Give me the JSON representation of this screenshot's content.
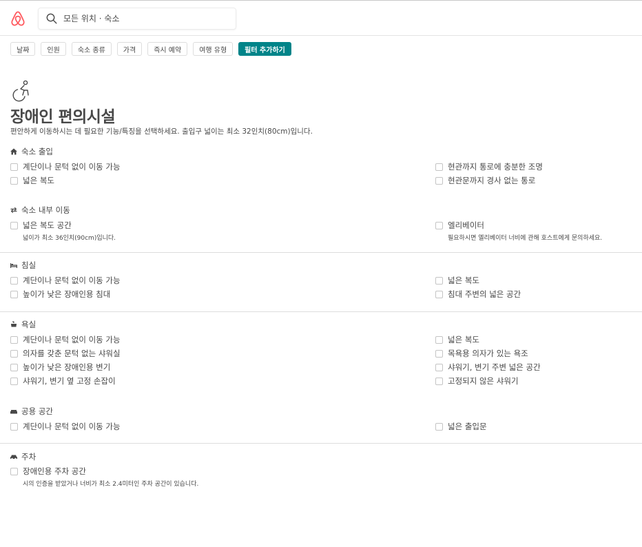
{
  "search": {
    "placeholder": "모든 위치 · 숙소"
  },
  "filters": [
    "날짜",
    "인원",
    "숙소 종류",
    "가격",
    "즉시 예약",
    "여행 유형"
  ],
  "more_filters_label": "필터 추가하기",
  "page": {
    "title": "장애인 편의시설",
    "description": "편안하게 이동하시는 데 필요한 기능/특징을 선택하세요. 출입구 넓이는 최소 32인치(80cm)입니다."
  },
  "sections": {
    "entrance": {
      "title": "숙소 출입",
      "icon": "home-icon",
      "left": [
        "계단이나 문턱 없이 이동 가능",
        "넓은 복도"
      ],
      "right": [
        "현관까지 통로에 충분한 조명",
        "현관문까지 경사 없는 통로"
      ]
    },
    "moving": {
      "title": "숙소 내부 이동",
      "icon": "swap-arrows-icon",
      "left": [
        {
          "label": "넓은 복도 공간",
          "sub": "넓이가 최소 36인치(90cm)입니다."
        }
      ],
      "right": [
        {
          "label": "엘리베이터",
          "sub": "필요하시면 엘리베이터 너비에 관해 호스트에게 문의하세요."
        }
      ]
    },
    "bedroom": {
      "title": "침실",
      "icon": "bed-icon",
      "left": [
        "계단이나 문턱 없이 이동 가능",
        "높이가 낮은 장애인용 침대"
      ],
      "right": [
        "넓은 복도",
        "침대 주변의 넓은 공간"
      ]
    },
    "bathroom": {
      "title": "욕실",
      "icon": "bath-icon",
      "left": [
        "계단이나 문턱 없이 이동 가능",
        "의자를 갖춘 문턱 없는 샤워실",
        "높이가 낮은 장애인용 변기",
        "샤워기, 변기 옆 고정 손잡이"
      ],
      "right": [
        "넓은 복도",
        "목욕용 의자가 있는 욕조",
        "샤워기, 변기 주변 넓은 공간",
        "고정되지 않은 샤워기"
      ]
    },
    "common": {
      "title": "공용 공간",
      "icon": "sofa-icon",
      "left": [
        "계단이나 문턱 없이 이동 가능"
      ],
      "right": [
        "넓은 출입문"
      ]
    },
    "parking": {
      "title": "주차",
      "icon": "car-icon",
      "left": [
        {
          "label": "장애인용 주차 공간",
          "sub": "시의 인증을 받았거나 너비가 최소 2.4미터인 주차 공간이 있습니다."
        }
      ]
    }
  },
  "colors": {
    "brand": "#FF5A5F",
    "accent": "#008489",
    "text": "#484848"
  }
}
